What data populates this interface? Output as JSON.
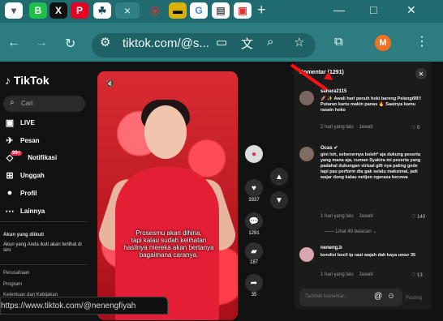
{
  "browser": {
    "address": "tiktok.com/@s...",
    "profile_initial": "M",
    "tabs": [
      "B",
      "X",
      "P",
      "☘",
      "×",
      "⦿",
      "▬",
      "G",
      "▤",
      "▣"
    ]
  },
  "sidebar": {
    "logo": "TikTok",
    "search_placeholder": "Cari",
    "items": [
      {
        "label": "LIVE"
      },
      {
        "label": "Pesan"
      },
      {
        "label": "Notifikasi",
        "badge": "99+"
      },
      {
        "label": "Unggah"
      },
      {
        "label": "Profil"
      },
      {
        "label": "Lainnya"
      }
    ],
    "following_title": "Akun yang diikuti",
    "following_desc": "Akun yang Anda ikuti akan terlihat di sini",
    "footer": [
      "Perusahaan",
      "Program",
      "Ketentuan dan Kebijakan"
    ]
  },
  "video": {
    "caption_line1": "Prosesmu akan dihina,",
    "caption_line2": "tapi kalau sudah kelihatan",
    "caption_line3": "hasilnya mereka akan bertanya",
    "caption_line4": "bagaimana caranya.",
    "likes": "3337",
    "comments": "1291",
    "saves": "187",
    "shares": "35"
  },
  "comments": {
    "header": "Komentar (1291)",
    "items": [
      {
        "name": "sahara2115",
        "text": "🚀 ✨ Awali hari penuh hoki bareng Pelangi99!! Putaran kartu makin panas 🔥 Saatnya kamu rasain hoko",
        "time": "2 hari yang lalu",
        "reply": "Jawab",
        "likes": "0"
      },
      {
        "name": "Ocas ✔",
        "text": "gini loh, sebenernya bolehº aja dukung peserta yang mana aja, cuman Syakira ini peserta yang padahal dukungan virtual gift nya paling gede tapi pas perform dia gak selalu maksimal, jadi wajar dong kalau netijen ngerasa kecewa",
        "time": "1 hari yang lalu",
        "reply": "Jawab",
        "likes": "140"
      },
      {
        "name": "neneng.b",
        "text": "kondisi bocil tp raut wajah dah kaya umur 35",
        "time": "1 hari yang lalu",
        "reply": "Jawab",
        "likes": "13"
      }
    ],
    "more": "Lihat 49 balasan",
    "input_placeholder": "Tambah komentar...",
    "post": "Posting"
  },
  "status": {
    "url": "https://www.tiktok.com/@nenengfiyah"
  },
  "colors": {
    "tiktok_red": "#fe2c55",
    "browser_teal": "#2c7c80"
  }
}
